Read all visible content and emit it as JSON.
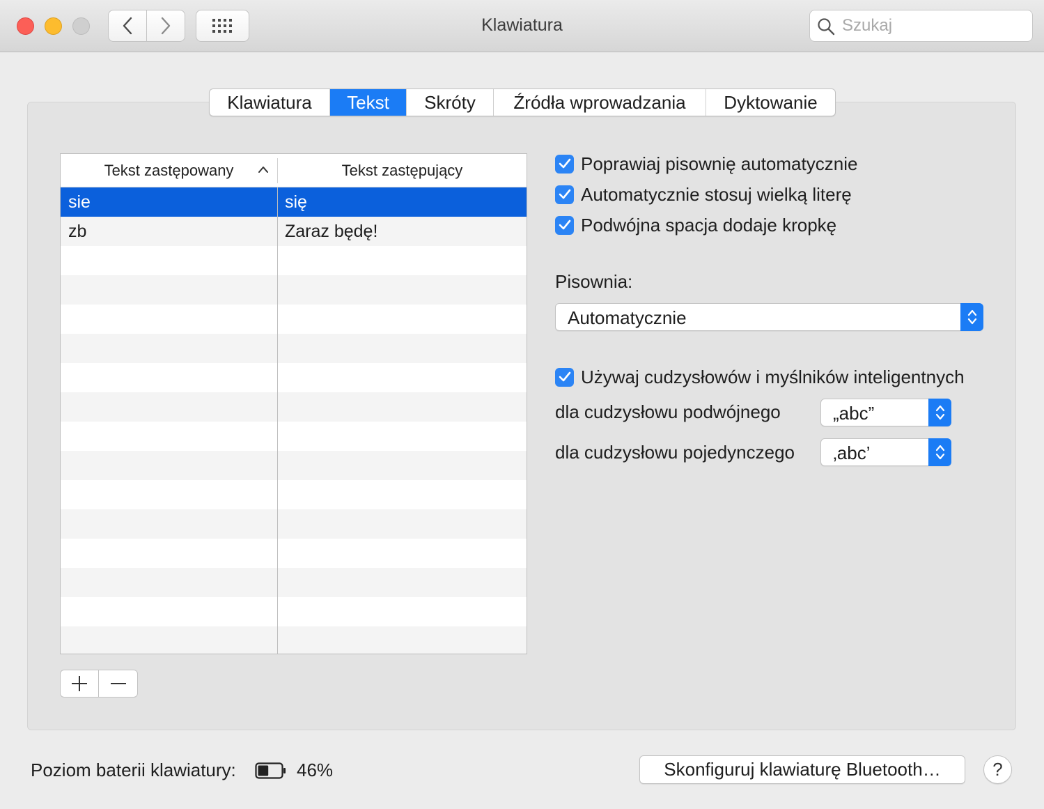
{
  "window": {
    "title": "Klawiatura",
    "search_placeholder": "Szukaj"
  },
  "tabs": [
    {
      "label": "Klawiatura",
      "active": false
    },
    {
      "label": "Tekst",
      "active": true
    },
    {
      "label": "Skróty",
      "active": false
    },
    {
      "label": "Źródła wprowadzania",
      "active": false
    },
    {
      "label": "Dyktowanie",
      "active": false
    }
  ],
  "table": {
    "columns": [
      "Tekst zastępowany",
      "Tekst zastępujący"
    ],
    "rows": [
      {
        "replace": "sie",
        "with": "się",
        "selected": true
      },
      {
        "replace": "zb",
        "with": "Zaraz będę!",
        "selected": false
      }
    ],
    "add_label": "+",
    "remove_label": "−"
  },
  "options": {
    "auto_correct": {
      "label": "Poprawiaj pisownię automatycznie",
      "checked": true
    },
    "auto_capitalize": {
      "label": "Automatycznie stosuj wielką literę",
      "checked": true
    },
    "double_space_period": {
      "label": "Podwójna spacja dodaje kropkę",
      "checked": true
    },
    "spelling_label": "Pisownia:",
    "spelling_value": "Automatycznie",
    "smart_quotes": {
      "label": "Używaj cudzysłowów i myślników inteligentnych",
      "checked": true
    },
    "double_quote_label": "dla cudzysłowu podwójnego",
    "double_quote_value": "„abc”",
    "single_quote_label": "dla cudzysłowu pojedynczego",
    "single_quote_value": "‚abc’"
  },
  "footer": {
    "battery_label": "Poziom baterii klawiatury:",
    "battery_percent": "46%",
    "battery_level": 0.46,
    "bluetooth_button": "Skonfiguruj klawiaturę Bluetooth…",
    "help_label": "?"
  },
  "colors": {
    "accent": "#1b7cf5",
    "selection": "#0b60dc",
    "close": "#fc5f57",
    "minimize": "#fdbc2e"
  }
}
